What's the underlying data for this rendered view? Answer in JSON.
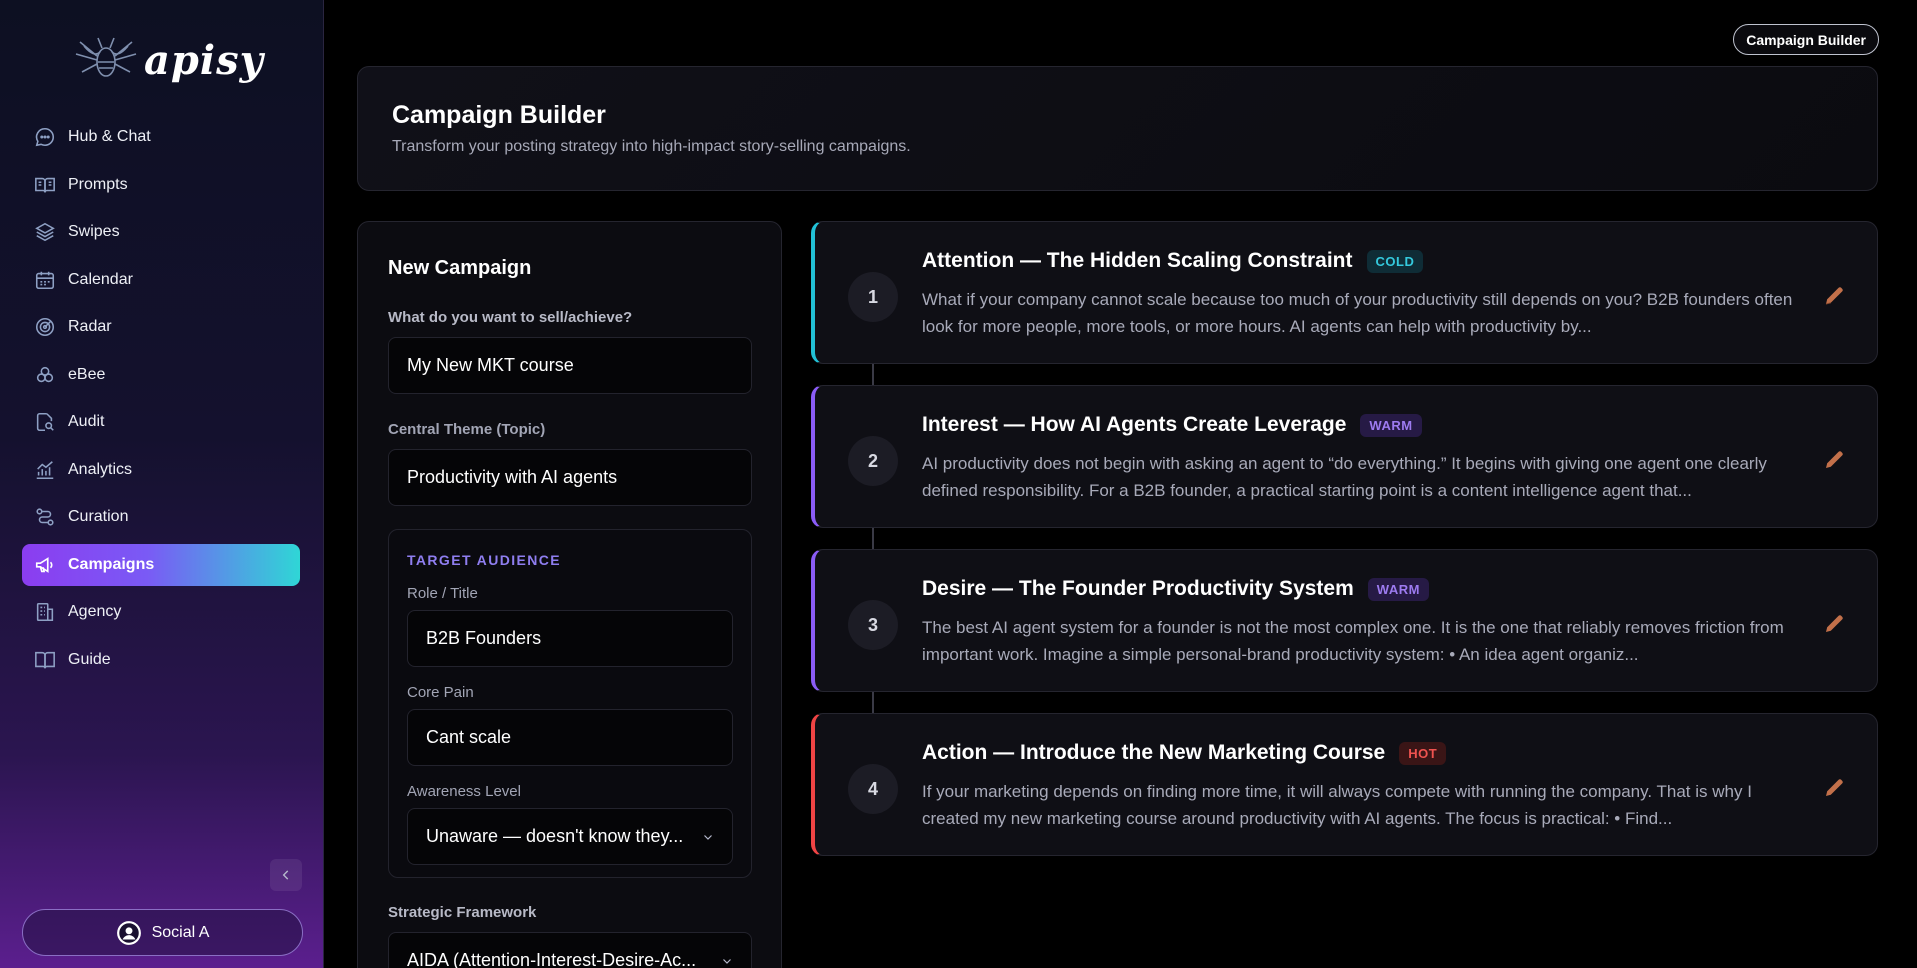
{
  "app": {
    "name": "apisy"
  },
  "sidebar": {
    "items": [
      {
        "label": "Hub & Chat",
        "icon": "chat-bubble-icon"
      },
      {
        "label": "Prompts",
        "icon": "book-open-icon"
      },
      {
        "label": "Swipes",
        "icon": "layers-icon"
      },
      {
        "label": "Calendar",
        "icon": "calendar-icon"
      },
      {
        "label": "Radar",
        "icon": "radar-icon"
      },
      {
        "label": "eBee",
        "icon": "hexagon-cluster-icon"
      },
      {
        "label": "Audit",
        "icon": "file-search-icon"
      },
      {
        "label": "Analytics",
        "icon": "trend-chart-icon"
      },
      {
        "label": "Curation",
        "icon": "route-icon"
      },
      {
        "label": "Campaigns",
        "icon": "megaphone-icon",
        "active": true
      },
      {
        "label": "Agency",
        "icon": "building-icon"
      },
      {
        "label": "Guide",
        "icon": "book-icon"
      }
    ],
    "profile_label": "Social A"
  },
  "topbar": {
    "badge": "Campaign Builder"
  },
  "header": {
    "title": "Campaign Builder",
    "subtitle": "Transform your posting strategy into high-impact story-selling campaigns."
  },
  "form": {
    "title": "New Campaign",
    "goal_label": "What do you want to sell/achieve?",
    "goal_value": "My New MKT course",
    "theme_label": "Central Theme (Topic)",
    "theme_value": "Productivity with AI agents",
    "audience": {
      "title": "TARGET AUDIENCE",
      "role_label": "Role / Title",
      "role_value": "B2B Founders",
      "pain_label": "Core Pain",
      "pain_value": "Cant scale",
      "awareness_label": "Awareness Level",
      "awareness_value": "Unaware — doesn't know they..."
    },
    "framework_label": "Strategic Framework",
    "framework_value": "AIDA (Attention-Interest-Desire-Ac..."
  },
  "steps": [
    {
      "num": "1",
      "title": "Attention — The Hidden Scaling Constraint",
      "tag": "COLD",
      "body": "What if your company cannot scale because too much of your productivity still depends on you? B2B founders often look for more people, more tools, or more hours. AI agents can help with productivity by..."
    },
    {
      "num": "2",
      "title": "Interest — How AI Agents Create Leverage",
      "tag": "WARM",
      "body": "AI productivity does not begin with asking an agent to “do everything.” It begins with giving one agent one clearly defined responsibility. For a B2B founder, a practical starting point is a content intelligence agent that..."
    },
    {
      "num": "3",
      "title": "Desire — The Founder Productivity System",
      "tag": "WARM",
      "body": "The best AI agent system for a founder is not the most complex one. It is the one that reliably removes friction from important work. Imagine a simple personal-brand productivity system: • An idea agent organiz..."
    },
    {
      "num": "4",
      "title": "Action — Introduce the New Marketing Course",
      "tag": "HOT",
      "body": "If your marketing depends on finding more time, it will always compete with running the company. That is why I created my new marketing course around productivity with AI agents. The focus is practical: • Find..."
    }
  ],
  "colors": {
    "cold": "#22c1d6",
    "warm": "#8b5cf6",
    "hot": "#ef4444",
    "edit_icon": "#c2704a"
  }
}
